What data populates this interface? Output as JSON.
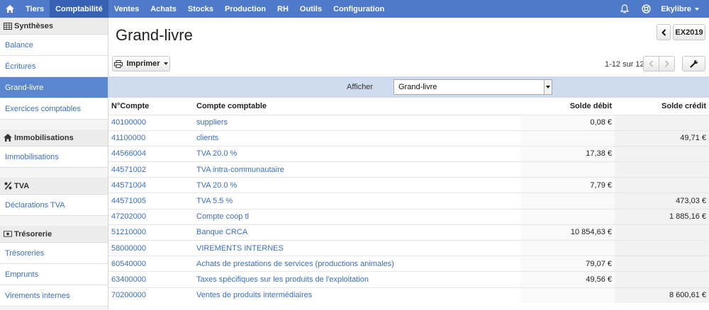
{
  "nav": {
    "items": [
      "Tiers",
      "Comptabilité",
      "Ventes",
      "Achats",
      "Stocks",
      "Production",
      "RH",
      "Outils",
      "Configuration"
    ],
    "active_index": 1,
    "user": "Ekylibre"
  },
  "sidebar": {
    "sections": [
      {
        "title": "Synthèses",
        "icon": "table-icon",
        "items": [
          "Balance",
          "Écritures",
          "Grand-livre",
          "Exercices comptables"
        ]
      },
      {
        "title": "Immobilisations",
        "icon": "home-icon",
        "items": [
          "Immobilisations"
        ]
      },
      {
        "title": "TVA",
        "icon": "percent-icon",
        "items": [
          "Déclarations TVA"
        ]
      },
      {
        "title": "Trésorerie",
        "icon": "money-icon",
        "items": [
          "Trésoreries",
          "Emprunts",
          "Virements internes"
        ]
      }
    ],
    "active_item": "Grand-livre"
  },
  "page": {
    "title": "Grand-livre",
    "exercise": "EX2019",
    "print_label": "Imprimer",
    "pager": "1-12 sur 12"
  },
  "filter": {
    "label": "Afficher",
    "value": "Grand-livre"
  },
  "table": {
    "headers": [
      "N°Compte",
      "Compte comptable",
      "Solde débit",
      "Solde crédit"
    ],
    "rows": [
      {
        "num": "40100000",
        "name": "suppliers",
        "debit": "0,08 €",
        "credit": ""
      },
      {
        "num": "41100000",
        "name": "clients",
        "debit": "",
        "credit": "49,71 €"
      },
      {
        "num": "44566004",
        "name": "TVA 20.0 %",
        "debit": "17,38 €",
        "credit": ""
      },
      {
        "num": "44571002",
        "name": "TVA intra-communautaire",
        "debit": "",
        "credit": ""
      },
      {
        "num": "44571004",
        "name": "TVA 20.0 %",
        "debit": "7,79 €",
        "credit": ""
      },
      {
        "num": "44571005",
        "name": "TVA 5.5 %",
        "debit": "",
        "credit": "473,03 €"
      },
      {
        "num": "47202000",
        "name": "Compte coop tl",
        "debit": "",
        "credit": "1 885,16 €"
      },
      {
        "num": "51210000",
        "name": "Banque CRCA",
        "debit": "10 854,63 €",
        "credit": ""
      },
      {
        "num": "58000000",
        "name": "VIREMENTS INTERNES",
        "debit": "",
        "credit": ""
      },
      {
        "num": "60540000",
        "name": "Achats de prestations de services (productions animales)",
        "debit": "79,07 €",
        "credit": ""
      },
      {
        "num": "63400000",
        "name": "Taxes spécifiques sur les produits de l'exploitation",
        "debit": "49,56 €",
        "credit": ""
      },
      {
        "num": "70200000",
        "name": "Ventes de produits intermédiaires",
        "debit": "",
        "credit": "8 600,61 €"
      }
    ]
  }
}
